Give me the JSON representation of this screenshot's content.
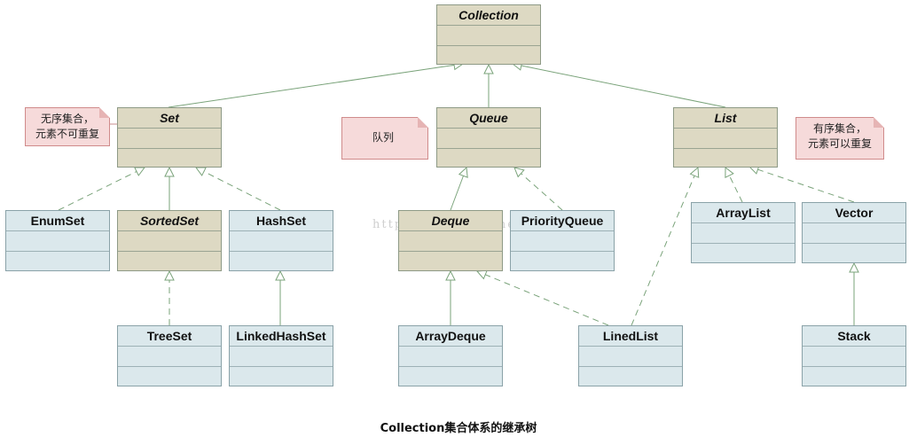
{
  "caption": "Collection集合体系的继承树",
  "watermark": "http://blog.csdn.net/",
  "classes": {
    "collection": "Collection",
    "set": "Set",
    "queue": "Queue",
    "list": "List",
    "enumset": "EnumSet",
    "sortedset": "SortedSet",
    "hashset": "HashSet",
    "deque": "Deque",
    "priorityqueue": "PriorityQueue",
    "arraylist": "ArrayList",
    "vector": "Vector",
    "treeset": "TreeSet",
    "linkedhashset": "LinkedHashSet",
    "arraydeque": "ArrayDeque",
    "linedlist": "LinedList",
    "stack": "Stack"
  },
  "notes": {
    "set_note": "无序集合，\n元素不可重复",
    "queue_note": "队列",
    "list_note": "有序集合，\n元素可以重复"
  },
  "colors": {
    "interface_fill": "#ddd9c3",
    "class_fill": "#dbe8ec",
    "note_fill": "#f6dada",
    "connector": "#7aa37a"
  }
}
